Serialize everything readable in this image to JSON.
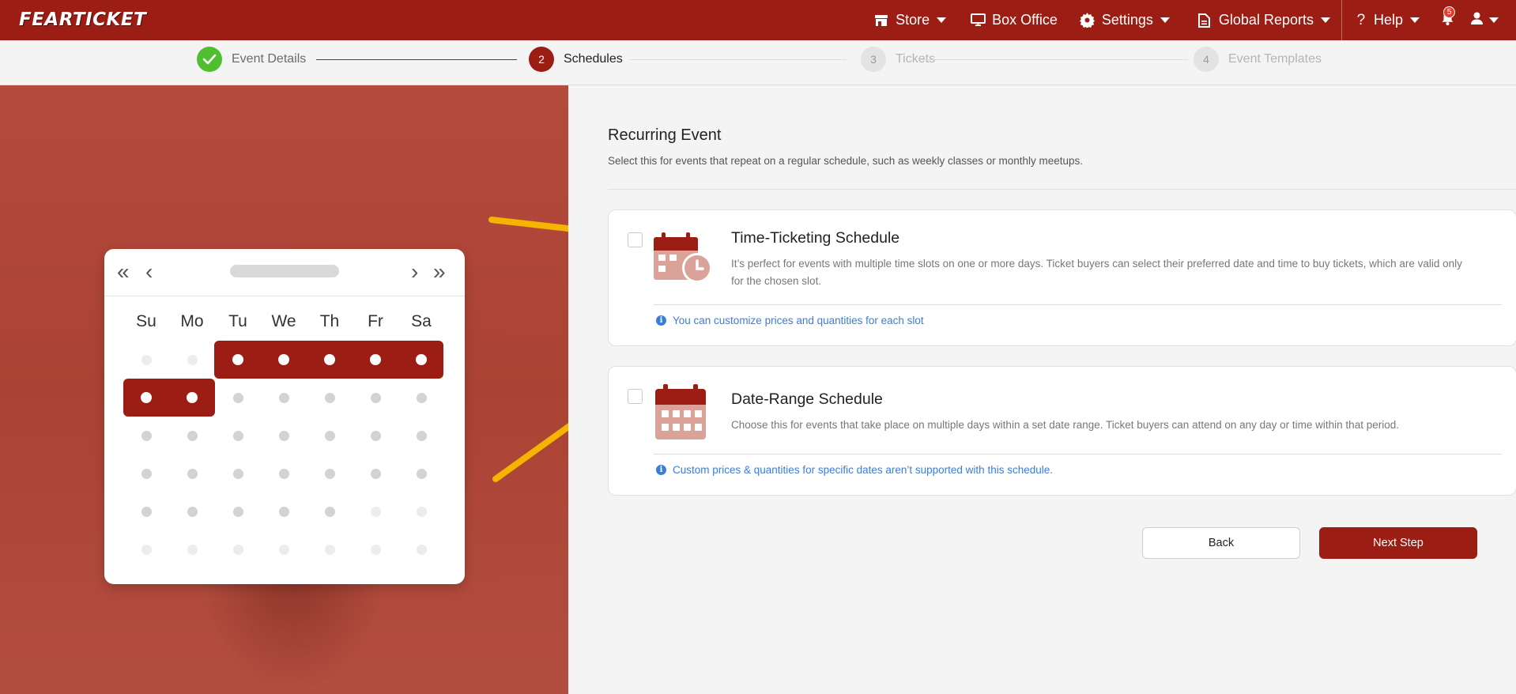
{
  "app": {
    "logo": "FEARTICKET"
  },
  "nav": {
    "items": [
      {
        "label": "Store",
        "icon": "store-icon",
        "dropdown": true
      },
      {
        "label": "Box Office",
        "icon": "monitor-icon",
        "dropdown": false
      },
      {
        "label": "Settings",
        "icon": "gear-icon",
        "dropdown": true
      },
      {
        "label": "Global Reports",
        "icon": "file-icon",
        "dropdown": true
      },
      {
        "label": "Help",
        "icon": "question-icon",
        "dropdown": true
      }
    ],
    "notifications_count": "5"
  },
  "stepper": {
    "steps": [
      {
        "number": "",
        "label": "Event Details",
        "state": "done"
      },
      {
        "number": "2",
        "label": "Schedules",
        "state": "active"
      },
      {
        "number": "3",
        "label": "Tickets",
        "state": "pending"
      },
      {
        "number": "4",
        "label": "Event Templates",
        "state": "pending"
      }
    ]
  },
  "calendar": {
    "nav": {
      "first": "«",
      "prev": "‹",
      "next": "›",
      "last": "»"
    },
    "weekdays": [
      "Su",
      "Mo",
      "Tu",
      "We",
      "Th",
      "Fr",
      "Sa"
    ]
  },
  "section": {
    "title": "Recurring Event",
    "description": "Select this for events that repeat on a regular schedule, such as weekly classes or monthly meetups."
  },
  "options": [
    {
      "title": "Time-Ticketing Schedule",
      "description": "It’s perfect for events with multiple time slots on one or more days. Ticket buyers can select their preferred date and time to buy tickets, which are valid only for the chosen slot.",
      "note": "You can customize prices and quantities for each slot",
      "checked": false
    },
    {
      "title": "Date-Range Schedule",
      "description": "Choose this for events that take place on multiple days within a set date range. Ticket buyers can attend on any day or time within that period.",
      "note": "Custom prices & quantities for specific dates aren’t supported with this schedule.",
      "checked": false
    }
  ],
  "buttons": {
    "back": "Back",
    "next": "Next Step"
  },
  "colors": {
    "brand": "#9b1d14",
    "success": "#4fbf2f",
    "info": "#3a7ddb",
    "arrow": "#f5b400"
  }
}
